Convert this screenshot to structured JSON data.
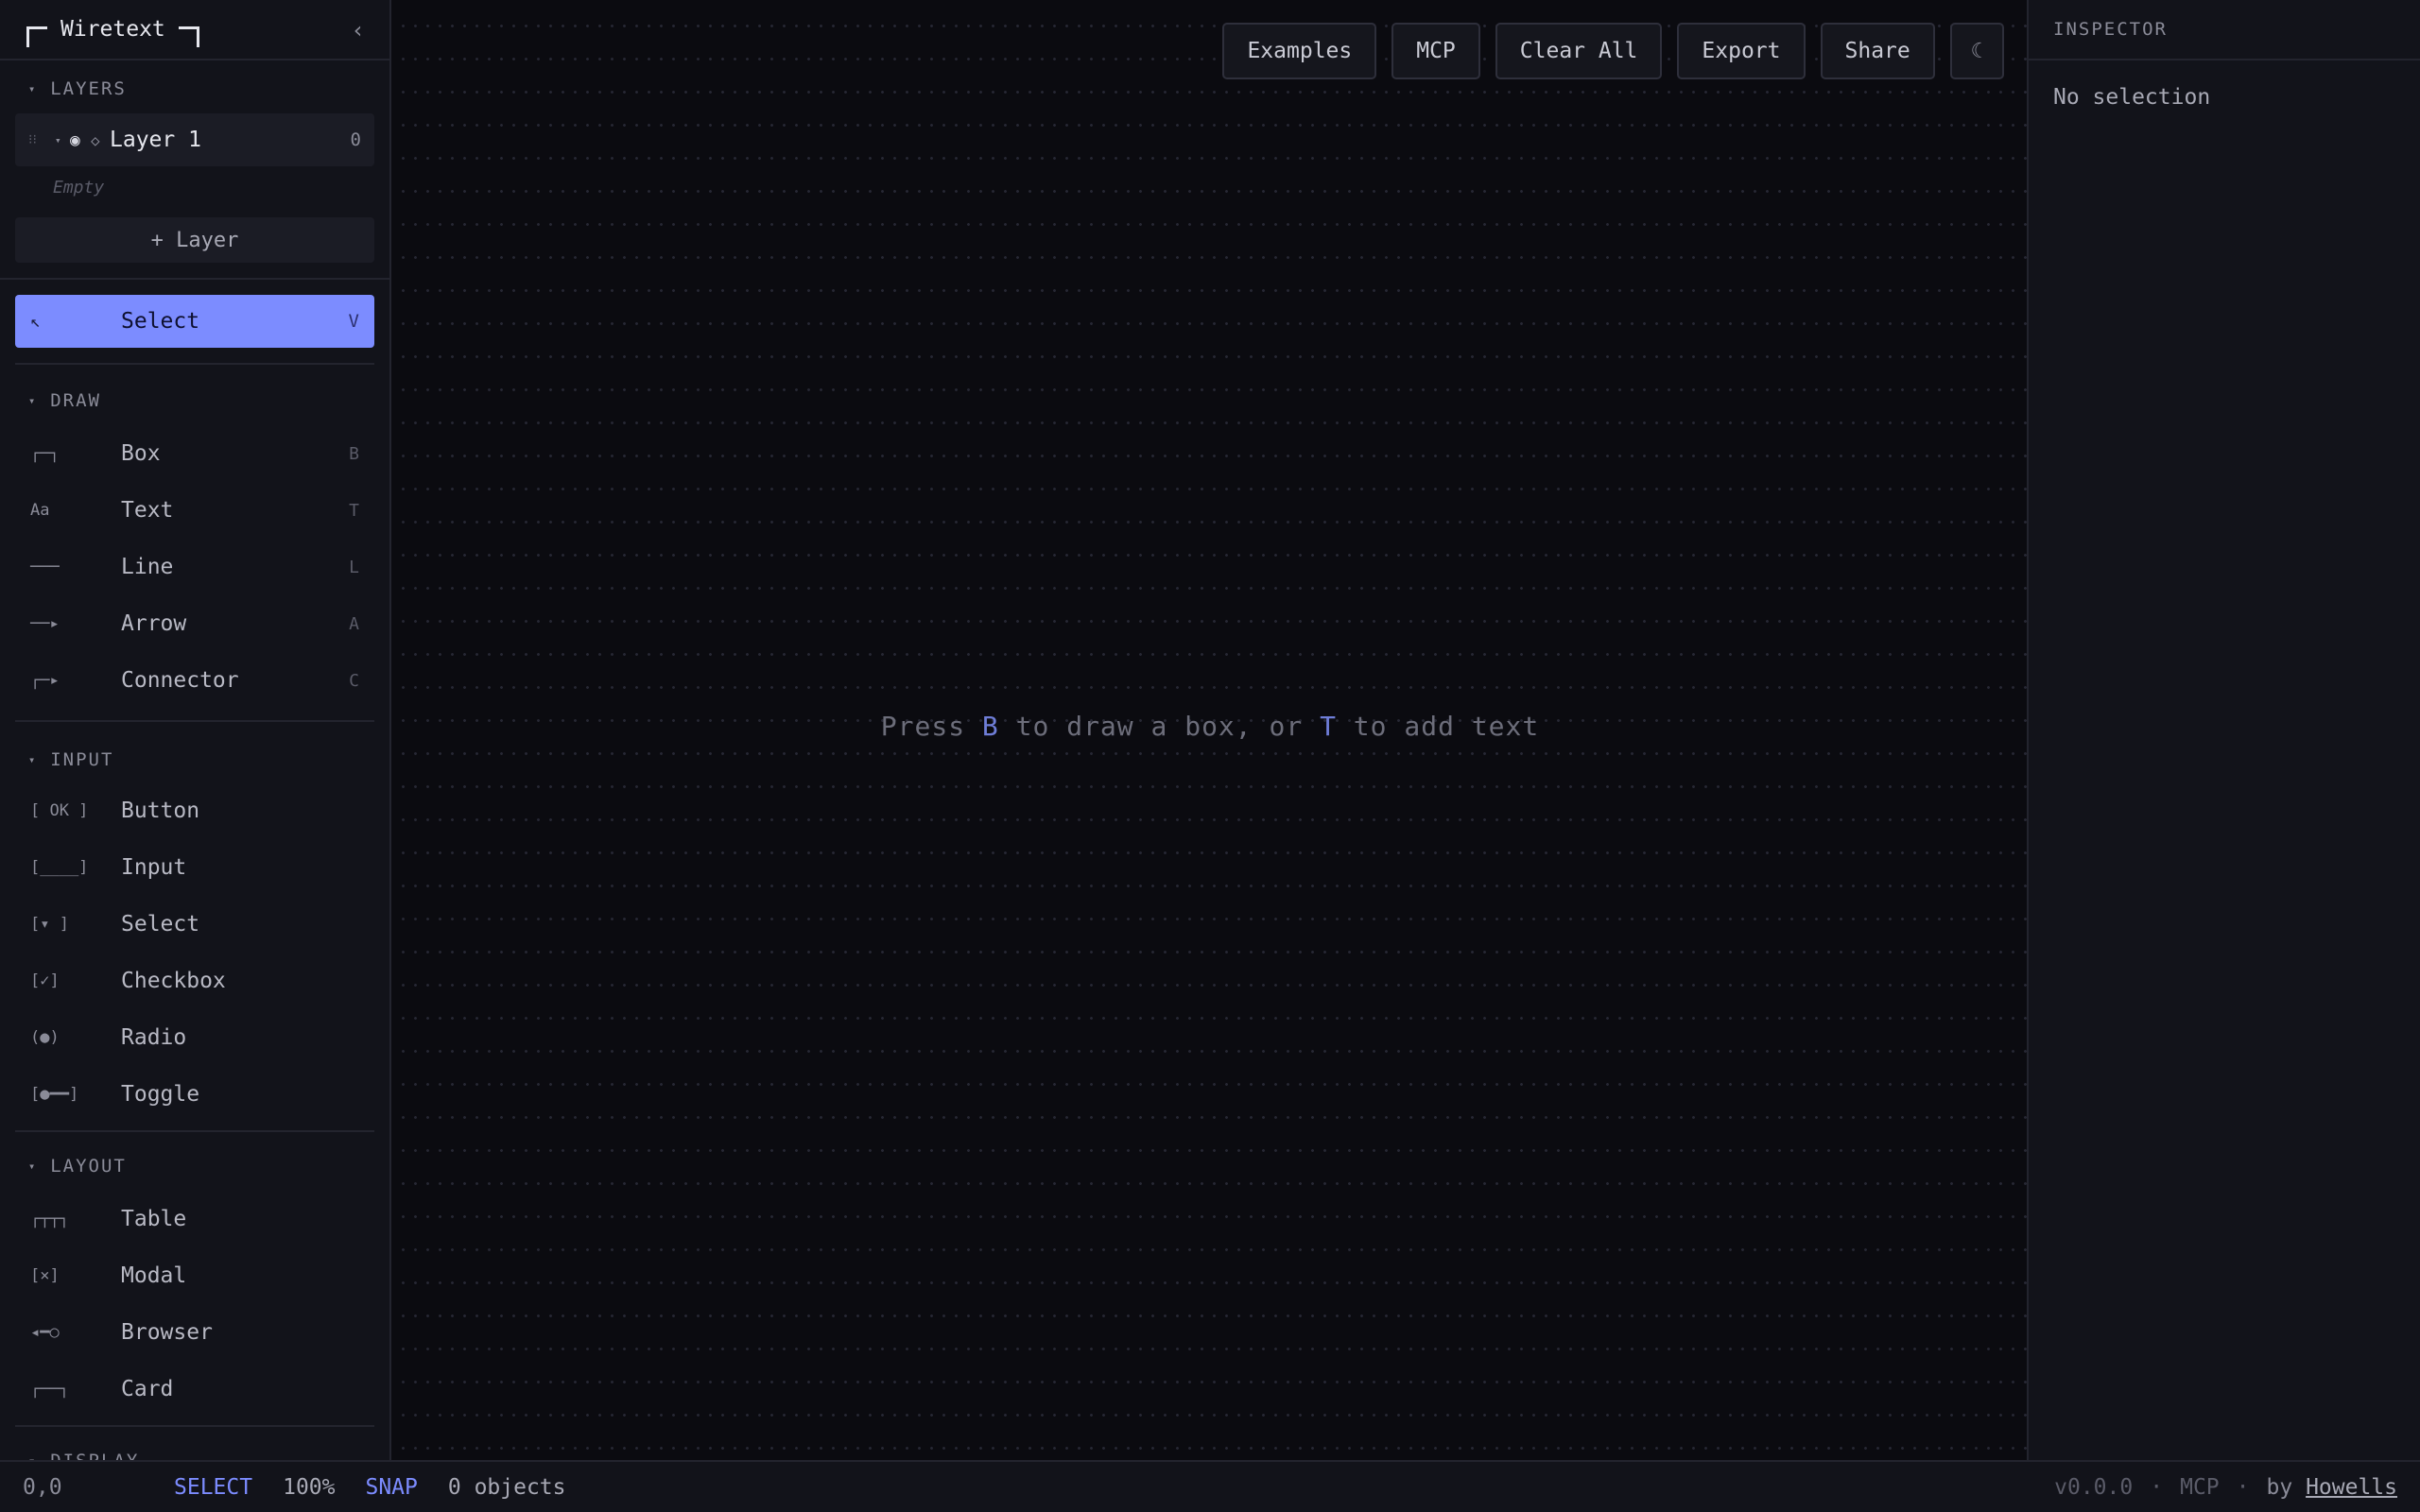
{
  "brand": {
    "name": "Wiretext",
    "collapse_icon": "‹"
  },
  "layers": {
    "heading": "LAYERS",
    "items": [
      {
        "name": "Layer 1",
        "count": "0"
      }
    ],
    "empty_text": "Empty",
    "add_label": "+ Layer"
  },
  "select_tool": {
    "icon": "↖",
    "label": "Select",
    "key": "V"
  },
  "draw": {
    "heading": "DRAW",
    "items": [
      {
        "icon": "┌─┐",
        "label": "Box",
        "key": "B"
      },
      {
        "icon": "Aa",
        "label": "Text",
        "key": "T"
      },
      {
        "icon": "───",
        "label": "Line",
        "key": "L"
      },
      {
        "icon": "──▸",
        "label": "Arrow",
        "key": "A"
      },
      {
        "icon": "┌─▸",
        "label": "Connector",
        "key": "C"
      }
    ]
  },
  "input": {
    "heading": "INPUT",
    "items": [
      {
        "icon": "[ OK ]",
        "label": "Button"
      },
      {
        "icon": "[____]",
        "label": "Input"
      },
      {
        "icon": "[▾ ]",
        "label": "Select"
      },
      {
        "icon": "[✓]",
        "label": "Checkbox"
      },
      {
        "icon": "(●)",
        "label": "Radio"
      },
      {
        "icon": "[●━━]",
        "label": "Toggle"
      }
    ]
  },
  "layout": {
    "heading": "LAYOUT",
    "items": [
      {
        "icon": "┌┬┬┐",
        "label": "Table"
      },
      {
        "icon": "[×]",
        "label": "Modal"
      },
      {
        "icon": "◂━○",
        "label": "Browser"
      },
      {
        "icon": "┌──┐",
        "label": "Card"
      }
    ]
  },
  "display": {
    "heading": "DISPLAY"
  },
  "toolbar": {
    "examples": "Examples",
    "mcp": "MCP",
    "clear_all": "Clear All",
    "export": "Export",
    "share": "Share",
    "theme_icon": "☾"
  },
  "hint": {
    "part1": "Press ",
    "key1": "B",
    "part2": " to draw a box, or ",
    "key2": "T",
    "part3": " to add text"
  },
  "inspector": {
    "heading": "INSPECTOR",
    "empty": "No selection"
  },
  "status": {
    "coords": "0,0",
    "mode": "SELECT",
    "zoom": "100%",
    "snap": "SNAP",
    "objects": "0 objects",
    "version": "v0.0.0",
    "sep": "·",
    "mcp": "MCP",
    "by": "by",
    "author": "Howells"
  }
}
